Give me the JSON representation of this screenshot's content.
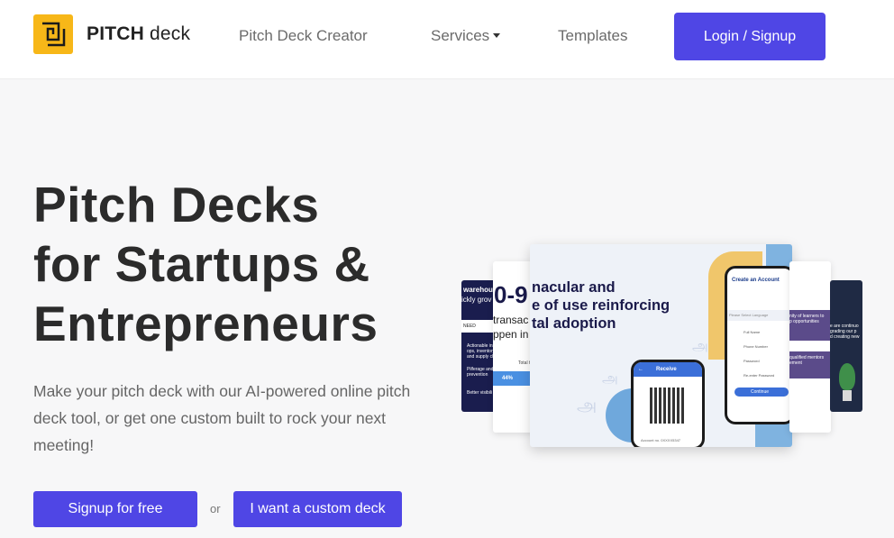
{
  "header": {
    "logo_bold": "PITCH",
    "logo_light": "deck",
    "nav": {
      "creator": "Pitch Deck Creator",
      "services": "Services",
      "templates": "Templates"
    },
    "login_label": "Login / Signup"
  },
  "hero": {
    "title_line1": "Pitch Decks",
    "title_line2": "for Startups &",
    "title_line3": "Entrepreneurs",
    "subtitle": "Make your pitch deck with our AI-powered online pitch deck tool, or get one custom built to rock your next meeting!",
    "signup_label": "Signup for free",
    "or_label": "or",
    "custom_label": "I want a custom deck"
  },
  "showcase": {
    "far_left": {
      "heading_1": "warehou",
      "heading_2": "ickly grov",
      "tag": "NEED",
      "bullet_1": "Actionable ins",
      "bullet_2": "ops, inventory",
      "bullet_3": "and supply ch",
      "bullet_4": "Pilferage and",
      "bullet_5": "prevention",
      "bullet_6": "Better visibili"
    },
    "left": {
      "big": "0-9",
      "line_1": "transac",
      "line_2": "ppen in",
      "total": "Total t",
      "percent": "44%"
    },
    "main": {
      "line_1": "nacular and",
      "line_2": "e of use reinforcing",
      "line_3": "tal adoption",
      "phone1_title": "Receive",
      "phone1_account": "Account no. 0XXXX5347",
      "phone2_title": "Create an Account",
      "phone2_language": "Please Select Language",
      "phone2_fullname": "Full Name",
      "phone2_phone": "Phone Number",
      "phone2_password": "Password",
      "phone2_reenter": "Re-enter Password",
      "phone2_continue": "Continue"
    },
    "right": {
      "text_1": "nity of learners to",
      "text_2": "p opportunities",
      "text_3": "qualified mentors",
      "text_4": "ement"
    },
    "far_right": {
      "text_1": "e are continuo",
      "text_2": "grading our p",
      "text_3": "d creating new"
    }
  }
}
